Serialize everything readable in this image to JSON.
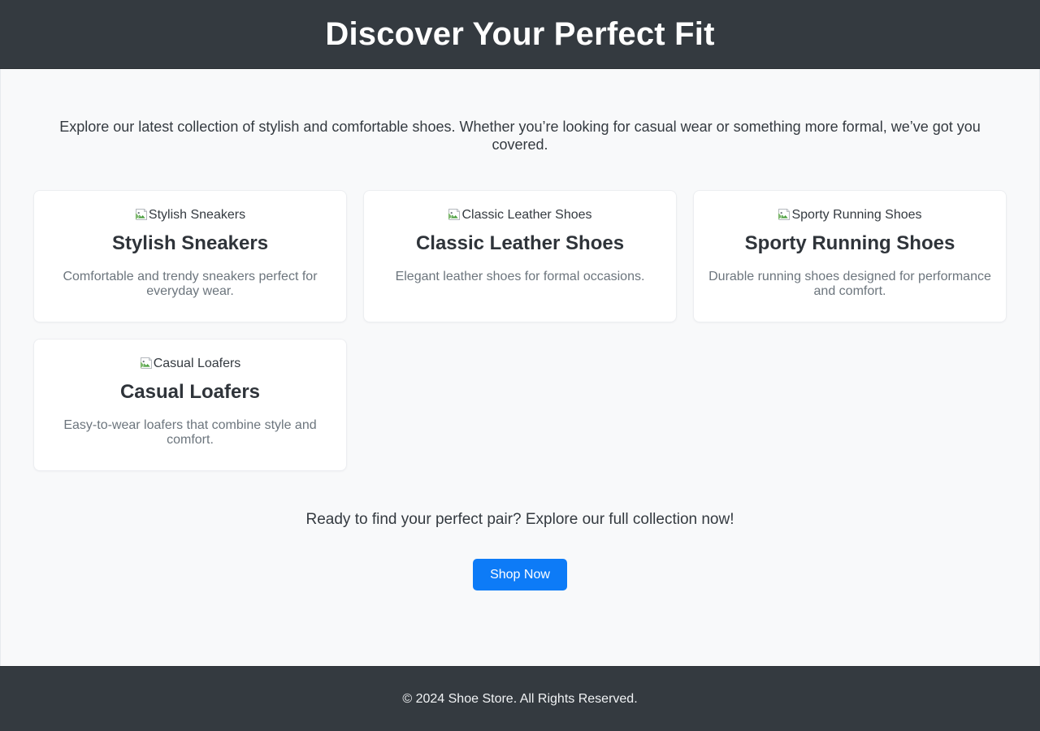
{
  "header": {
    "title": "Discover Your Perfect Fit"
  },
  "main": {
    "intro": "Explore our latest collection of stylish and comfortable shoes. Whether you’re looking for casual wear or something more formal, we’ve got you covered.",
    "cards": [
      {
        "image_alt": "Stylish Sneakers",
        "image_icon": "broken-image-icon",
        "title": "Stylish Sneakers",
        "description": "Comfortable and trendy sneakers perfect for everyday wear."
      },
      {
        "image_alt": "Classic Leather Shoes",
        "image_icon": "broken-image-icon",
        "title": "Classic Leather Shoes",
        "description": "Elegant leather shoes for formal occasions."
      },
      {
        "image_alt": "Sporty Running Shoes",
        "image_icon": "broken-image-icon",
        "title": "Sporty Running Shoes",
        "description": "Durable running shoes designed for performance and comfort."
      },
      {
        "image_alt": "Casual Loafers",
        "image_icon": "broken-image-icon",
        "title": "Casual Loafers",
        "description": "Easy-to-wear loafers that combine style and comfort."
      }
    ]
  },
  "cta": {
    "text": "Ready to find your perfect pair? Explore our full collection now!",
    "button_label": "Shop Now"
  },
  "footer": {
    "copyright": "© 2024 Shoe Store. All Rights Reserved."
  },
  "colors": {
    "header_background": "#343a40",
    "footer_background": "#343a40",
    "page_background": "#f8f9fa",
    "card_background": "#ffffff",
    "accent_button": "#0d7bf7",
    "heading_text": "#2f343a",
    "muted_text": "#6c757d"
  }
}
